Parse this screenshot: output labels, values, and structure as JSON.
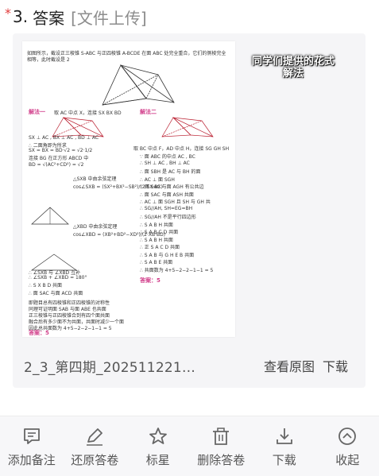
{
  "question": {
    "star": "*",
    "number": "3.",
    "title": "答案",
    "tag": "[文件上传]"
  },
  "attachment": {
    "file_name": "2_3_第四期_202511221…",
    "view_original": "查看原图",
    "download": "下载",
    "overlay_caption": "同学们提供的花式解法",
    "document": {
      "intro": "如图所示，截设正三棱锥 S-ABC 与正四棱锥 A-BCDE 在面 ABC 处完全重合，它们的侧棱完全相等，此时截设是 2",
      "solution1_heading": "解法一",
      "solution1_note": "取 AC 中点 X，连接 SX BX BD",
      "solution2_heading": "解法二",
      "solution2_note": "取 BC 中点 F，AD 中点 H，连接 SG GH SH",
      "lines_left": [
        "SX ⊥ AC , BX ⊥ AC , BD ⊥ AC",
        "∴ 二面角即为所求",
        "SX = BX = BD·√2 = √2·1/2",
        "连接 BG 在正方形 ABCD 中",
        "BD = √(AC²+CD²) = √2",
        "△SXB 中由余弦定理",
        "cos∠SXB = (SX²+BX²−SB²)/(2·SX·BX)",
        "△XBD 中由余弦定理",
        "cos∠XBD = (XB²+BD²−XD²)/(2·XB·BD)",
        "∴ ∠SXB 与 ∠XBD 互补",
        "∴ ∠SXB + ∠XBD = 180°",
        "∴ S X B D 共面",
        "∴ 面 SAC 与面 ACD 共面",
        "即题目总有四棱锥和正四棱锥的对称性",
        "同理可证明面 SAB 与面 ABE 也共面",
        "正三棱锥与正四棱锥合到有四个面共面",
        "融合后有多少面不为共面，共面时减少一个面",
        "因此总共面数为 4+5−2−2−1−1 = 5"
      ],
      "answer_left": "答案：5",
      "lines_right": [
        "∵ 面 ABC 的中点 AC , BC",
        "∴ SH ⊥ AC , BH ⊥ AC",
        "∴ 面 SBH 是 AC 与 BH 的面",
        "∴ AC ⊥ 面 SGH",
        "∵ 面 SAC 与面 AGH 有公共边",
        "∴ 面 SAC 与面 ASH 共面",
        "∴ AC ⊥ 面 SGH 且 SH 与 GH 共",
        "∴ SG//AH, SH=EG=BH",
        "∴ SG//AH 不是平行四边形",
        "∴ S A B H 共面",
        "∴ S A B C D 共面",
        "∴ S A B H 共面",
        "∴ 正 S A C D 共面",
        "∴ S A B 与 G H E B 共面",
        "∴ S A B E 共面",
        "∴ 共面数为 4+5−2−2−1−1 = 5"
      ],
      "answer_right": "答案：5"
    }
  },
  "toolbar": [
    {
      "id": "add-note",
      "label": "添加备注",
      "icon": "comment-icon"
    },
    {
      "id": "restore-answer",
      "label": "还原答卷",
      "icon": "pen-icon"
    },
    {
      "id": "star",
      "label": "标星",
      "icon": "star-icon"
    },
    {
      "id": "delete-answer",
      "label": "删除答卷",
      "icon": "trash-icon"
    },
    {
      "id": "download",
      "label": "下载",
      "icon": "download-icon"
    },
    {
      "id": "collapse",
      "label": "收起",
      "icon": "collapse-icon"
    }
  ],
  "colors": {
    "required_star": "#e23b3b",
    "card_bg": "#f5f5f7",
    "toolbar_bg": "#f7f7f9",
    "handwriting_pink": "#d13d8a"
  }
}
